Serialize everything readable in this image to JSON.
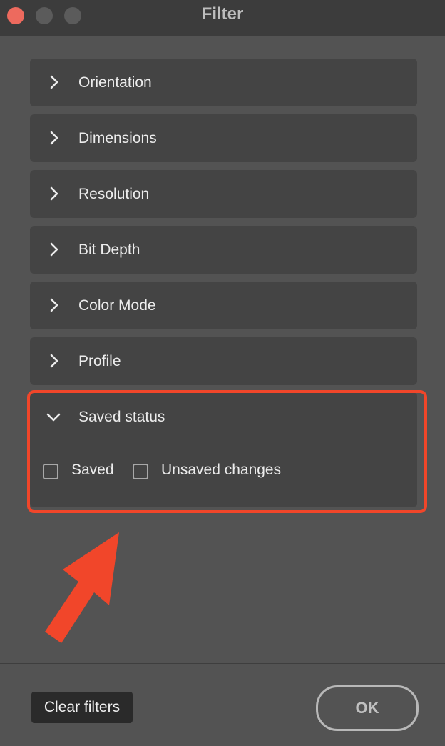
{
  "window": {
    "title": "Filter",
    "buttons": [
      "close",
      "minimize",
      "maximize"
    ]
  },
  "sections": [
    {
      "label": "Orientation",
      "expanded": false,
      "icon": "chevron-right-icon"
    },
    {
      "label": "Dimensions",
      "expanded": false,
      "icon": "chevron-right-icon"
    },
    {
      "label": "Resolution",
      "expanded": false,
      "icon": "chevron-right-icon"
    },
    {
      "label": "Bit Depth",
      "expanded": false,
      "icon": "chevron-right-icon"
    },
    {
      "label": "Color Mode",
      "expanded": false,
      "icon": "chevron-right-icon"
    },
    {
      "label": "Profile",
      "expanded": false,
      "icon": "chevron-right-icon"
    }
  ],
  "saved_status": {
    "label": "Saved status",
    "expanded": true,
    "icon": "chevron-down-icon",
    "options": [
      {
        "label": "Saved",
        "checked": false
      },
      {
        "label": "Unsaved changes",
        "checked": false
      }
    ]
  },
  "annotation": {
    "highlight_color": "#f1462a",
    "arrow_icon": "annotation-arrow-icon"
  },
  "footer": {
    "clear_label": "Clear filters",
    "ok_label": "OK"
  },
  "colors": {
    "background": "#535353",
    "panel": "#444444",
    "titlebar": "#3c3c3c",
    "close_button": "#ed6a5e"
  }
}
